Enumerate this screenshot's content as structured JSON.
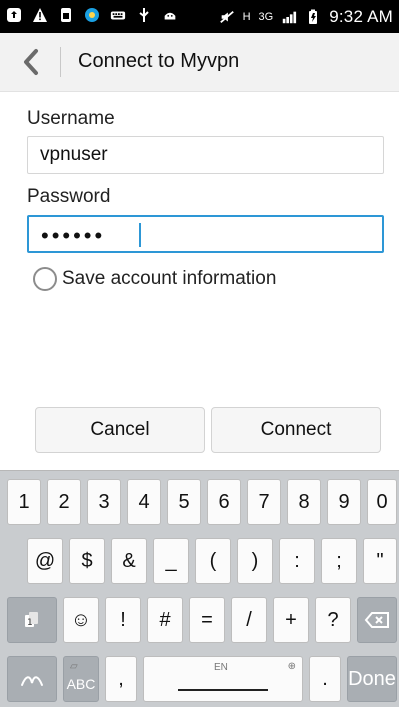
{
  "statusbar": {
    "icons": [
      "upload-icon",
      "alert-icon",
      "sim-card-icon",
      "app-icon",
      "keyboard-icon",
      "usb-icon",
      "android-icon"
    ],
    "network": "H",
    "mobile_data": "3G",
    "time": "9:32 AM"
  },
  "appbar": {
    "title": "Connect to Myvpn"
  },
  "form": {
    "username_label": "Username",
    "username_value": "vpnuser",
    "password_label": "Password",
    "password_mask": "••••••",
    "save_account_label": "Save account information"
  },
  "buttons": {
    "cancel": "Cancel",
    "connect": "Connect"
  },
  "keyboard": {
    "row1": [
      "1",
      "2",
      "3",
      "4",
      "5",
      "6",
      "7",
      "8",
      "9",
      "0"
    ],
    "row2": [
      "@",
      "$",
      "&",
      "_",
      "(",
      ")",
      ":",
      ";",
      "\""
    ],
    "row3": [
      "☺",
      "!",
      "#",
      "=",
      "/",
      "+",
      "?"
    ],
    "abc": "ABC",
    "comma": ",",
    "space_language": "EN",
    "period": ".",
    "done": "Done"
  }
}
